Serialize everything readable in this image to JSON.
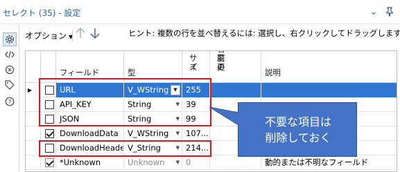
{
  "window": {
    "title": "セレクト (35) - 設定",
    "dropdown_icon": "chevron-down-icon",
    "pin_icon": "pin-icon"
  },
  "sidebar": {
    "icons": [
      "gear-icon",
      "code-icon",
      "connection-icon",
      "tag-icon",
      "help-icon"
    ]
  },
  "toolbar": {
    "options_label": "オプション",
    "hint": "ヒント: 複数の行を並べ替えるには: 選択し、右クリックしてドラッグします。"
  },
  "grid": {
    "headers": {
      "field": "フィールド",
      "type": "型",
      "size_line1": "サイ",
      "size_line2": "ズ",
      "rename_line1": "名前の",
      "rename_line2": "変更",
      "description": "説明"
    },
    "rows": [
      {
        "checked": false,
        "field": "URL",
        "type": "V_WString",
        "size": "255",
        "rename": "",
        "description": "",
        "selected": true
      },
      {
        "checked": false,
        "field": "API_KEY",
        "type": "String",
        "size": "39",
        "rename": "",
        "description": ""
      },
      {
        "checked": false,
        "field": "JSON",
        "type": "String",
        "size": "99",
        "rename": "",
        "description": ""
      },
      {
        "checked": true,
        "field": "DownloadData",
        "type": "V_WString",
        "size": "107...",
        "rename": "",
        "description": ""
      },
      {
        "checked": false,
        "field": "DownloadHeaders",
        "type": "V_String",
        "size": "214...",
        "rename": "",
        "description": ""
      },
      {
        "checked": true,
        "field": "*Unknown",
        "type": "Unknown",
        "size": "0",
        "rename": "",
        "description": "動的または不明なフィールド",
        "muted": true
      }
    ]
  },
  "callout": {
    "line1": "不要な項目は",
    "line2": "削除しておく"
  },
  "colors": {
    "selection": "#2f76d2",
    "highlight_box": "#e0181b",
    "callout_fill": "#4472c4",
    "title_text": "#2e5f9e"
  }
}
